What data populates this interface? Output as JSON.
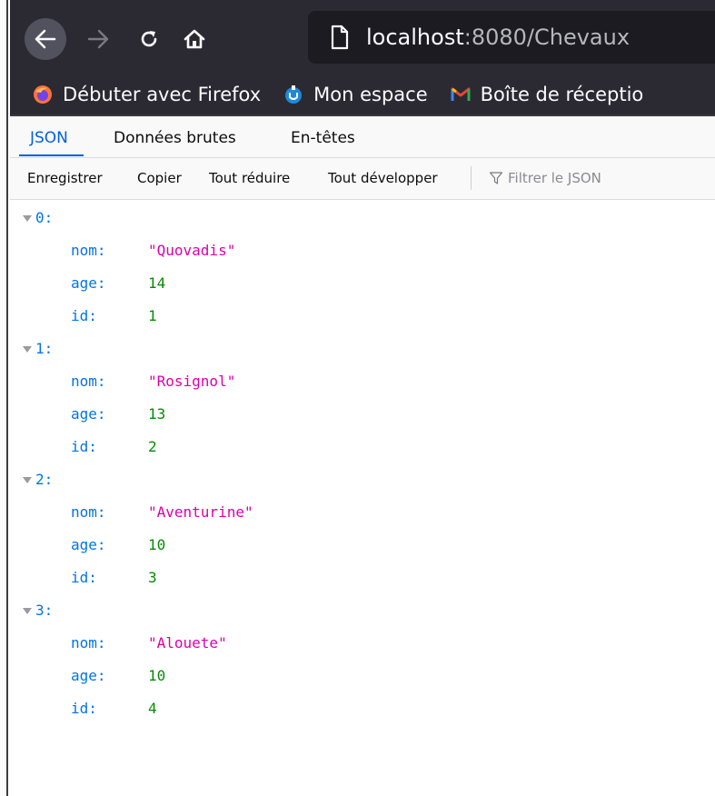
{
  "browser": {
    "url_host": "localhost",
    "url_path": ":8080/Chevaux",
    "bookmarks": [
      {
        "label": "Débuter avec Firefox",
        "icon": "firefox-icon"
      },
      {
        "label": "Mon espace",
        "icon": "mon-espace-icon"
      },
      {
        "label": "Boîte de réceptio",
        "icon": "gmail-icon"
      }
    ]
  },
  "viewer": {
    "tabs": [
      "JSON",
      "Données brutes",
      "En-têtes"
    ],
    "active_tab": "JSON",
    "toolbar": {
      "save": "Enregistrer",
      "copy": "Copier",
      "collapse_all": "Tout réduire",
      "expand_all": "Tout développer",
      "filter_placeholder": "Filtrer le JSON"
    }
  },
  "json": [
    {
      "index": "0:",
      "nom_key": "nom:",
      "nom": "\"Quovadis\"",
      "age_key": "age:",
      "age": "14",
      "id_key": "id:",
      "id": "1"
    },
    {
      "index": "1:",
      "nom_key": "nom:",
      "nom": "\"Rosignol\"",
      "age_key": "age:",
      "age": "13",
      "id_key": "id:",
      "id": "2"
    },
    {
      "index": "2:",
      "nom_key": "nom:",
      "nom": "\"Aventurine\"",
      "age_key": "age:",
      "age": "10",
      "id_key": "id:",
      "id": "3"
    },
    {
      "index": "3:",
      "nom_key": "nom:",
      "nom": "\"Alouete\"",
      "age_key": "age:",
      "age": "10",
      "id_key": "id:",
      "id": "4"
    }
  ],
  "colors": {
    "chrome_bg": "#2b2a33",
    "urlbar_bg": "#1c1b22",
    "accent": "#0060df",
    "json_key": "#0074e8",
    "json_string": "#dd00a9",
    "json_number": "#058b00"
  }
}
